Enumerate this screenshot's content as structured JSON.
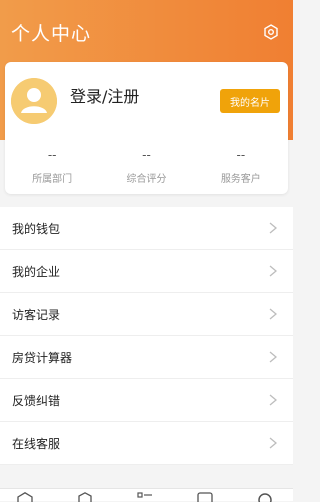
{
  "header": {
    "title": "个人中心",
    "settings_icon": "settings-icon",
    "background_color": "#f07f32"
  },
  "profile": {
    "login_text": "登录/注册",
    "namecard_label": "我的名片",
    "namecard_color": "#f0a30a",
    "avatar_icon": "user-avatar-icon",
    "stats": [
      {
        "value": "--",
        "label": "所属部门"
      },
      {
        "value": "--",
        "label": "综合评分"
      },
      {
        "value": "--",
        "label": "服务客户"
      }
    ]
  },
  "menu": [
    {
      "label": "我的钱包"
    },
    {
      "label": "我的企业"
    },
    {
      "label": "访客记录"
    },
    {
      "label": "房贷计算器"
    },
    {
      "label": "反馈纠错"
    },
    {
      "label": "在线客服"
    }
  ],
  "tabbar": {
    "icons": [
      "home-icon",
      "box-icon",
      "list-icon",
      "message-icon",
      "profile-icon"
    ]
  }
}
